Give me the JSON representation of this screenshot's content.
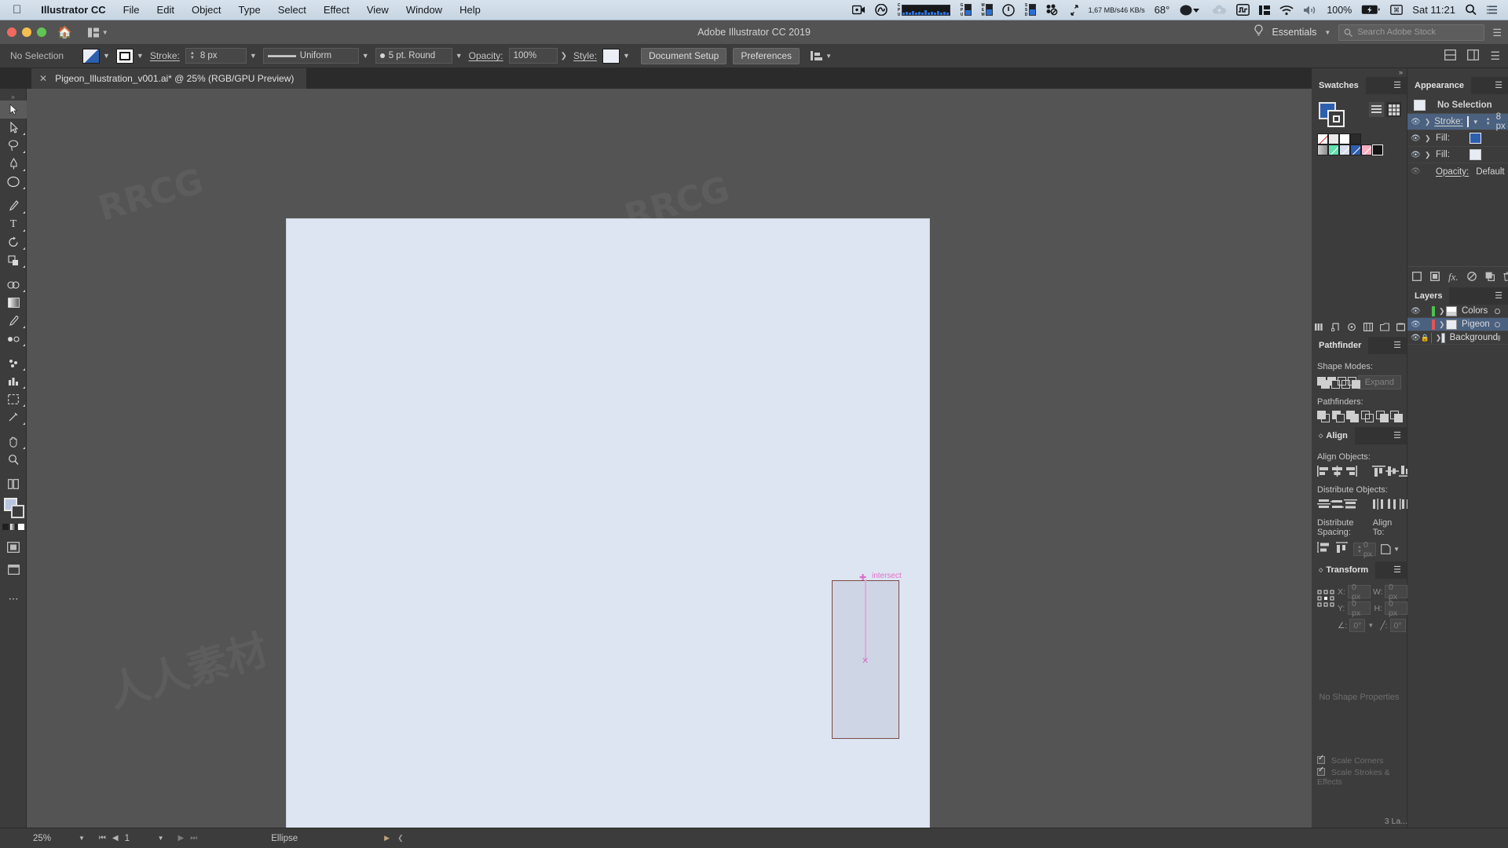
{
  "macos_menubar": {
    "apple_icon": "apple-icon",
    "app_name": "Illustrator CC",
    "menus": [
      "File",
      "Edit",
      "Object",
      "Type",
      "Select",
      "Effect",
      "View",
      "Window",
      "Help"
    ],
    "status_items": {
      "cpu_label": "CPU",
      "gpu_label": "GPU",
      "mem_label": "MEM",
      "ssd_label": "SSD",
      "net_down": "1,67 MB/s",
      "net_up": "46 KB/s",
      "temperature": "68°",
      "battery_percent": "100%",
      "clock": "Sat 11:21"
    }
  },
  "app_titlebar": {
    "document_title": "Adobe Illustrator CC 2019",
    "workspace": "Essentials",
    "search_placeholder": "Search Adobe Stock"
  },
  "control_bar": {
    "selection_status": "No Selection",
    "stroke_label": "Stroke:",
    "stroke_weight": "8 px",
    "profile": "Uniform",
    "brush": "5 pt. Round",
    "opacity_label": "Opacity:",
    "opacity_value": "100%",
    "style_label": "Style:",
    "document_setup": "Document Setup",
    "preferences": "Preferences"
  },
  "tab": {
    "close_icon": "close-icon",
    "title": "Pigeon_Illustration_v001.ai* @ 25% (RGB/GPU Preview)"
  },
  "toolbar": {
    "tools": [
      {
        "name": "selection-tool",
        "glyph": "↖"
      },
      {
        "name": "direct-selection-tool",
        "glyph": "↗"
      },
      {
        "name": "lasso-tool",
        "glyph": "❂"
      },
      {
        "name": "pen-tool",
        "glyph": "✒"
      },
      {
        "name": "ellipse-tool",
        "glyph": "◯"
      },
      {
        "name": "paintbrush-tool",
        "glyph": "✎"
      },
      {
        "name": "type-tool",
        "glyph": "T"
      },
      {
        "name": "rotate-tool",
        "glyph": "↻"
      },
      {
        "name": "gradient-mesh-tool",
        "glyph": "◆"
      },
      {
        "name": "shape-builder-tool",
        "glyph": "⬚"
      },
      {
        "name": "gradient-tool",
        "glyph": "▤"
      },
      {
        "name": "eyedropper-tool",
        "glyph": "✐"
      },
      {
        "name": "blend-tool",
        "glyph": "❦"
      },
      {
        "name": "artboard-tool",
        "glyph": "▢"
      },
      {
        "name": "zoom-tool",
        "glyph": "⌕"
      },
      {
        "name": "hand-tool",
        "glyph": "✋"
      },
      {
        "name": "more-tools",
        "glyph": "•••"
      }
    ]
  },
  "artboard": {
    "background_color": "#dde5f2",
    "palette_row_one": [
      "#201f1f",
      "#68e5b2",
      "#fdafbc"
    ],
    "palette_row_two": [
      "#dae1ef",
      "#ccd5e8",
      "#b7c2dd",
      "#a4b2d3",
      "#6c84bf",
      "#3a5ba9"
    ],
    "selected_shape_fill": "#ced6e6",
    "selected_shape_stroke": "#7c4a46",
    "smart_guide_label": "intersect",
    "smart_guide_color": "#e46fc9"
  },
  "swatches_panel": {
    "title": "Swatches",
    "menu_icon": "hamburger-icon",
    "fill_color": "#2d5faf",
    "view_list_icon": "list-view-icon",
    "view_grid_icon": "grid-view-icon",
    "swatch_row_one": [
      "none",
      "registration",
      "white",
      "#2b2b2b"
    ],
    "swatch_row_two": [
      "gradient",
      "#5fe0ad",
      "#d6deef",
      "#2d5faf",
      "#fbb0c0",
      "#141414"
    ],
    "footer_icons": [
      "swatch-libraries-icon",
      "show-swatch-kinds-icon",
      "color-groups-icon",
      "edit-swatch-icon",
      "new-color-group-icon",
      "new-swatch-icon",
      "delete-swatch-icon"
    ]
  },
  "appearance_panel": {
    "title": "Appearance",
    "menu_icon": "hamburger-icon",
    "target_label": "No Selection",
    "rows": [
      {
        "label": "Stroke:",
        "stroke_weight": "8 px",
        "selected": true
      },
      {
        "label": "Fill:",
        "selected": false
      },
      {
        "label": "Fill:",
        "selected": false
      }
    ],
    "opacity_label": "Opacity:",
    "opacity_value": "Default",
    "footer_icons": [
      "add-new-stroke-icon",
      "add-new-fill-icon",
      "add-effect-icon",
      "clear-appearance-icon",
      "duplicate-item-icon",
      "delete-item-icon"
    ]
  },
  "layers_panel": {
    "title": "Layers",
    "menu_icon": "hamburger-icon",
    "layers": [
      {
        "name": "Colors",
        "color": "#4cc24c",
        "locked": false,
        "selected": false
      },
      {
        "name": "Pigeon",
        "color": "#e05555",
        "locked": false,
        "selected": true
      },
      {
        "name": "Background",
        "color": "#5566d8",
        "locked": true,
        "selected": false
      }
    ],
    "footer_count": "3 La..."
  },
  "pathfinder_panel": {
    "title": "Pathfinder",
    "menu_icon": "hamburger-icon",
    "shape_modes_label": "Shape Modes:",
    "shape_modes": [
      "unite-icon",
      "minus-front-icon",
      "intersect-icon",
      "exclude-icon"
    ],
    "expand_button": "Expand",
    "pathfinders_label": "Pathfinders:",
    "pathfinders": [
      "divide-icon",
      "trim-icon",
      "merge-icon",
      "crop-icon",
      "outline-icon",
      "minus-back-icon"
    ]
  },
  "align_panel": {
    "title": "Align",
    "menu_icon": "hamburger-icon",
    "align_objects_label": "Align Objects:",
    "align_objects": [
      "align-left-icon",
      "align-horizontal-center-icon",
      "align-right-icon",
      "align-top-icon",
      "align-vertical-center-icon",
      "align-bottom-icon"
    ],
    "distribute_objects_label": "Distribute Objects:",
    "distribute_objects": [
      "distribute-top-icon",
      "distribute-vertical-center-icon",
      "distribute-bottom-icon",
      "distribute-left-icon",
      "distribute-horizontal-center-icon",
      "distribute-right-icon"
    ],
    "distribute_spacing_label": "Distribute Spacing:",
    "distribute_spacing_value": "0 px",
    "align_to_label": "Align To:",
    "align_to_icon": "align-to-selection-icon"
  },
  "transform_panel": {
    "title": "Transform",
    "menu_icon": "hamburger-icon",
    "reference_point_icon": "reference-point-grid",
    "x_label": "X:",
    "x_value": "0 px",
    "y_label": "Y:",
    "y_value": "0 px",
    "w_label": "W:",
    "w_value": "0 px",
    "h_label": "H:",
    "h_value": "0 px",
    "angle_label": "∠:",
    "angle_value": "0°",
    "shear_label": "╱:",
    "shear_value": "0°",
    "link_icon": "broken-link-icon",
    "no_shape_properties": "No Shape Properties",
    "scale_corners": "Scale Corners",
    "scale_strokes": "Scale Strokes & Effects",
    "scale_corners_checked": true,
    "scale_strokes_checked": true
  },
  "status_bar": {
    "zoom_value": "25%",
    "page_value": "1",
    "tool_name": "Ellipse"
  }
}
